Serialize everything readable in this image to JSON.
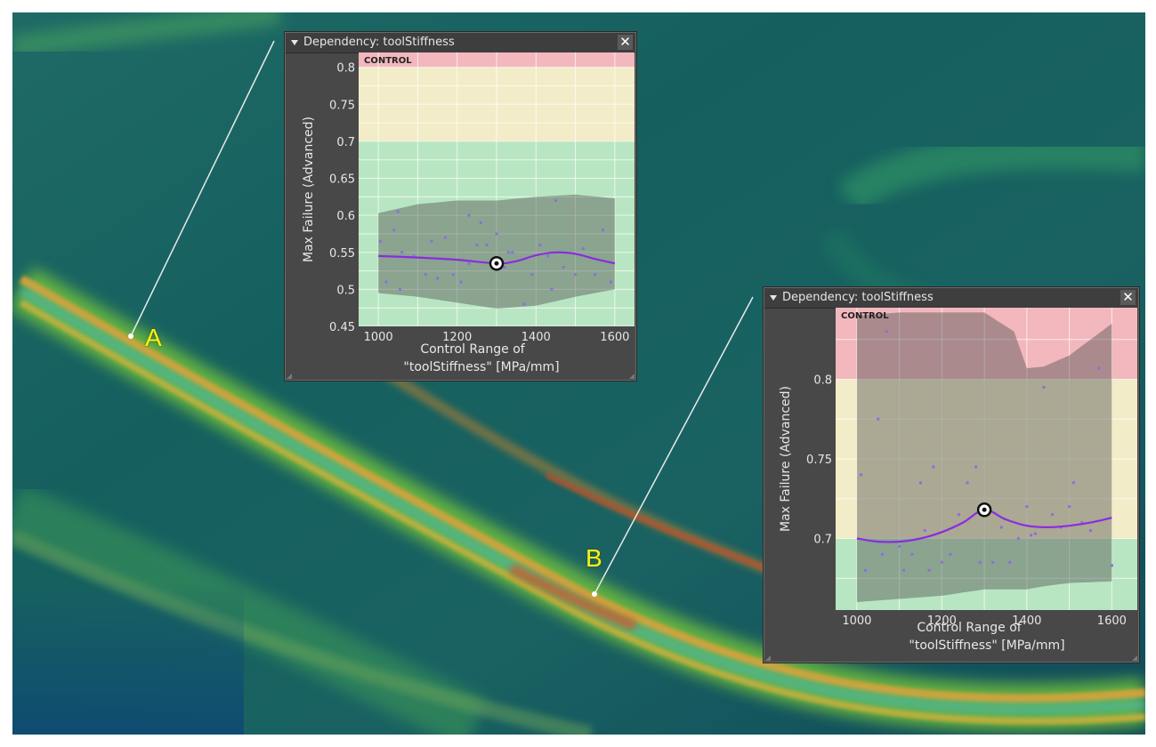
{
  "annotations": {
    "point_a": "A",
    "point_b": "B"
  },
  "colors": {
    "band_red": "#f2b8bd",
    "band_yellow": "#f2edc8",
    "band_green": "#b8e6c2",
    "curve": "#8a2be2",
    "scatter": "#8c6fd9"
  },
  "panel_a": {
    "title": "Dependency: toolStiffness",
    "close_label": "✕",
    "collapse_icon": "triangle-down-icon",
    "xlabel_line1": "Control Range of",
    "xlabel_line2": "\"toolStiffness\" [MPa/mm]"
  },
  "panel_b": {
    "title": "Dependency: toolStiffness",
    "close_label": "✕",
    "collapse_icon": "triangle-down-icon",
    "xlabel_line1": "Control Range of",
    "xlabel_line2": "\"toolStiffness\" [MPa/mm]"
  },
  "chart_data": [
    {
      "type": "line",
      "ylabel": "Max Failure (Advanced)",
      "xlabel": "Control Range of \"toolStiffness\" [MPa/mm]",
      "xlim": [
        950,
        1650
      ],
      "ylim": [
        0.45,
        0.82
      ],
      "xticks": [
        1000,
        1200,
        1400,
        1600
      ],
      "yticks": [
        0.45,
        0.5,
        0.55,
        0.6,
        0.65,
        0.7,
        0.75,
        0.8
      ],
      "ytick_labels": [
        "0.45",
        "0.5",
        "0.55",
        "0.6",
        "0.65",
        "0.7",
        "0.75",
        "0.8"
      ],
      "grid": true,
      "bands": [
        {
          "label": "CONTROL",
          "from": 0.8,
          "to": 0.82,
          "color": "red"
        },
        {
          "from": 0.7,
          "to": 0.8,
          "color": "yellow"
        },
        {
          "from": 0.45,
          "to": 0.7,
          "color": "green"
        }
      ],
      "curve": {
        "x": [
          1000,
          1100,
          1200,
          1300,
          1350,
          1400,
          1450,
          1500,
          1550,
          1600
        ],
        "y": [
          0.545,
          0.543,
          0.54,
          0.535,
          0.538,
          0.546,
          0.55,
          0.548,
          0.541,
          0.535
        ]
      },
      "confidence": {
        "x": [
          1000,
          1100,
          1200,
          1300,
          1400,
          1500,
          1600
        ],
        "upper": [
          0.603,
          0.615,
          0.62,
          0.62,
          0.625,
          0.628,
          0.623
        ],
        "lower": [
          0.495,
          0.49,
          0.482,
          0.474,
          0.478,
          0.49,
          0.5
        ]
      },
      "marker": {
        "x": 1300,
        "y": 0.535
      },
      "scatter": {
        "x": [
          1005,
          1020,
          1040,
          1050,
          1060,
          1090,
          1120,
          1135,
          1150,
          1170,
          1190,
          1210,
          1230,
          1250,
          1260,
          1275,
          1300,
          1320,
          1340,
          1370,
          1390,
          1410,
          1430,
          1450,
          1470,
          1500,
          1520,
          1550,
          1570,
          1590,
          1055,
          1230,
          1440,
          1330
        ],
        "y": [
          0.565,
          0.51,
          0.58,
          0.605,
          0.55,
          0.545,
          0.52,
          0.565,
          0.515,
          0.57,
          0.52,
          0.51,
          0.535,
          0.56,
          0.59,
          0.56,
          0.575,
          0.53,
          0.55,
          0.48,
          0.52,
          0.56,
          0.545,
          0.62,
          0.53,
          0.52,
          0.555,
          0.52,
          0.58,
          0.51,
          0.5,
          0.6,
          0.5,
          0.55
        ]
      }
    },
    {
      "type": "line",
      "ylabel": "Max Failure (Advanced)",
      "xlabel": "Control Range of \"toolStiffness\" [MPa/mm]",
      "xlim": [
        950,
        1660
      ],
      "ylim": [
        0.655,
        0.845
      ],
      "xticks": [
        1000,
        1200,
        1400,
        1600
      ],
      "yticks": [
        0.7,
        0.75,
        0.8
      ],
      "ytick_labels": [
        "0.7",
        "0.75",
        "0.8"
      ],
      "grid": true,
      "bands": [
        {
          "label": "CONTROL",
          "from": 0.8,
          "to": 0.845,
          "color": "red"
        },
        {
          "from": 0.7,
          "to": 0.8,
          "color": "yellow"
        },
        {
          "from": 0.655,
          "to": 0.7,
          "color": "green"
        }
      ],
      "curve": {
        "x": [
          1000,
          1050,
          1100,
          1150,
          1200,
          1250,
          1300,
          1350,
          1400,
          1450,
          1500,
          1550,
          1600
        ],
        "y": [
          0.7,
          0.698,
          0.698,
          0.7,
          0.704,
          0.71,
          0.718,
          0.712,
          0.708,
          0.707,
          0.708,
          0.71,
          0.713
        ]
      },
      "confidence": {
        "x": [
          1000,
          1100,
          1200,
          1300,
          1370,
          1400,
          1440,
          1500,
          1600
        ],
        "upper": [
          0.84,
          0.842,
          0.842,
          0.842,
          0.83,
          0.807,
          0.808,
          0.815,
          0.835
        ],
        "lower": [
          0.66,
          0.662,
          0.664,
          0.668,
          0.668,
          0.668,
          0.67,
          0.672,
          0.673
        ]
      },
      "marker": {
        "x": 1300,
        "y": 0.718
      },
      "scatter": {
        "x": [
          1010,
          1020,
          1050,
          1060,
          1070,
          1100,
          1110,
          1130,
          1150,
          1160,
          1170,
          1180,
          1200,
          1220,
          1240,
          1260,
          1280,
          1290,
          1300,
          1320,
          1340,
          1360,
          1380,
          1400,
          1410,
          1420,
          1440,
          1460,
          1480,
          1500,
          1510,
          1530,
          1550,
          1570,
          1600
        ],
        "y": [
          0.74,
          0.68,
          0.775,
          0.69,
          0.83,
          0.695,
          0.68,
          0.69,
          0.735,
          0.705,
          0.68,
          0.745,
          0.685,
          0.69,
          0.715,
          0.735,
          0.745,
          0.685,
          0.72,
          0.685,
          0.707,
          0.685,
          0.7,
          0.72,
          0.702,
          0.703,
          0.795,
          0.715,
          0.707,
          0.72,
          0.735,
          0.71,
          0.705,
          0.807,
          0.683
        ]
      }
    }
  ]
}
